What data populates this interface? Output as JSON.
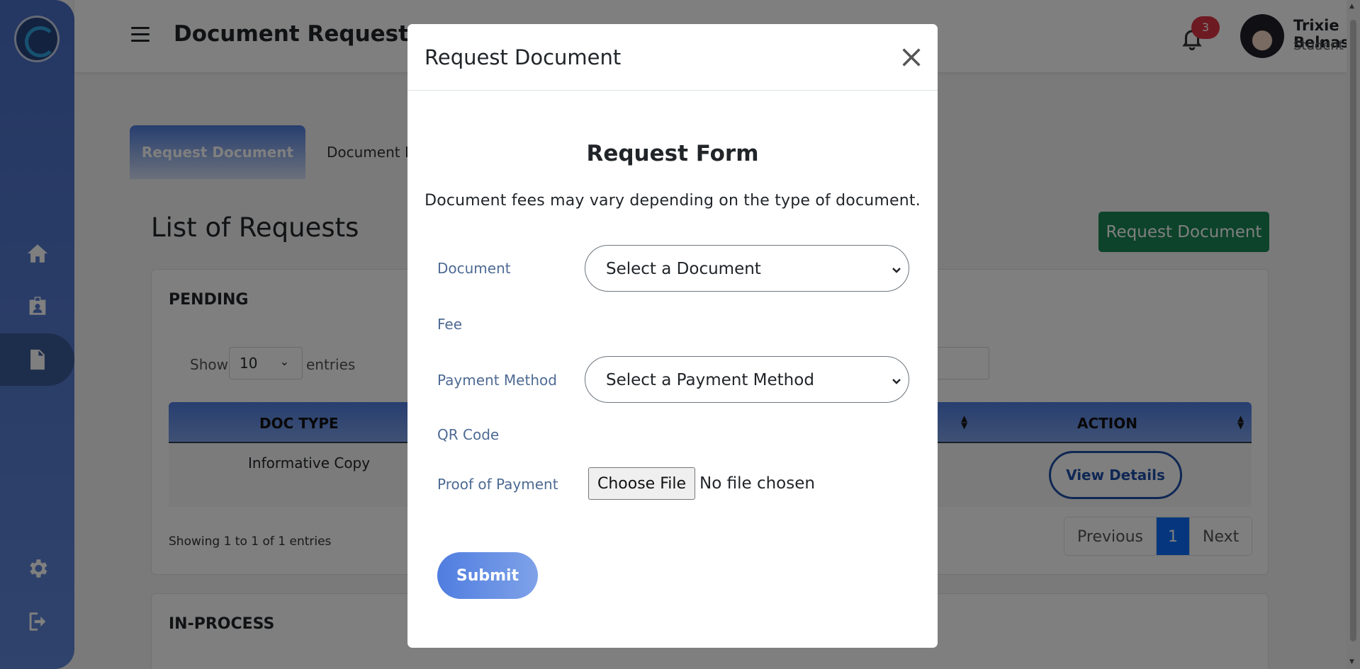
{
  "header": {
    "title": "Document Requests",
    "notification_count": "3",
    "user_name": "Trixie Belnas",
    "user_role": "Student"
  },
  "sidebar": {
    "items": [
      {
        "icon": "home-icon"
      },
      {
        "icon": "id-badge-icon"
      },
      {
        "icon": "document-icon",
        "active": true
      },
      {
        "icon": "gear-icon"
      },
      {
        "icon": "logout-icon"
      }
    ]
  },
  "tabs": {
    "active": "Request Document",
    "inactive": "Document D"
  },
  "main": {
    "list_title": "List of Requests",
    "request_button": "Request Document"
  },
  "pending": {
    "title": "PENDING",
    "show_label": "Show",
    "show_value": "10",
    "entries_label": "entries",
    "columns": [
      "DOC TYPE",
      "ACTION"
    ],
    "rows": [
      {
        "doc_type": "Informative Copy",
        "action": "View Details"
      }
    ],
    "showing": "Showing 1 to 1 of 1 entries",
    "pagination": {
      "previous": "Previous",
      "current": "1",
      "next": "Next"
    }
  },
  "inprocess": {
    "title": "IN-PROCESS"
  },
  "modal": {
    "title": "Request Document",
    "form_title": "Request Form",
    "description": "Document fees may vary depending on the type of document.",
    "fields": {
      "document_label": "Document",
      "document_value": "Select a Document",
      "fee_label": "Fee",
      "payment_label": "Payment Method",
      "payment_value": "Select a Payment Method",
      "qr_label": "QR Code",
      "proof_label": "Proof of Payment",
      "choose_file": "Choose File",
      "no_file": "No file chosen"
    },
    "submit": "Submit"
  },
  "colors": {
    "sidebar": "#4a6fc6",
    "accent": "#4f7de0",
    "success": "#198754",
    "badge": "#dc3545",
    "page_active": "#0d6efd"
  }
}
